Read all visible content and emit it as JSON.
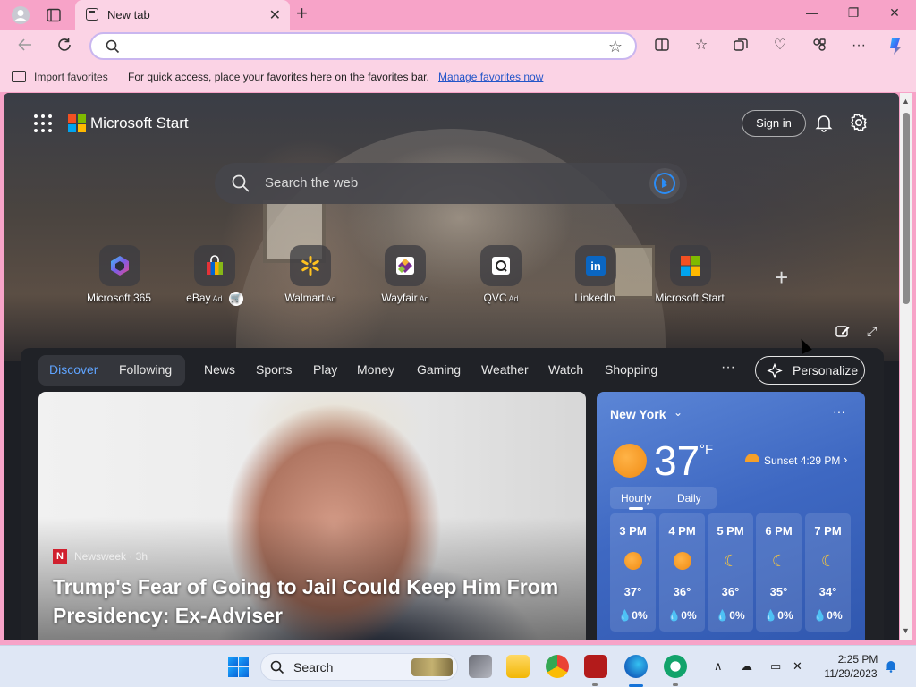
{
  "browser": {
    "tab_title": "New tab",
    "new_tab_glyph": "+",
    "address_value": "",
    "favorites_bar": {
      "import_label": "Import favorites",
      "message": "For quick access, place your favorites here on the favorites bar.",
      "link": "Manage favorites now"
    },
    "icons": [
      "profile-icon",
      "tab-actions-icon",
      "back-icon",
      "refresh-icon",
      "search-icon",
      "favorite-star-icon",
      "split-screen-icon",
      "favorites-icon",
      "collections-icon",
      "browser-essentials-icon",
      "extensions-icon",
      "more-icon",
      "copilot-icon"
    ]
  },
  "start": {
    "brand": "Microsoft Start",
    "sign_in": "Sign in",
    "search_placeholder": "Search the web",
    "tiles": [
      {
        "label": "Microsoft 365",
        "ad": ""
      },
      {
        "label": "eBay",
        "ad": "Ad"
      },
      {
        "label": "Walmart",
        "ad": "Ad"
      },
      {
        "label": "Wayfair",
        "ad": "Ad"
      },
      {
        "label": "QVC",
        "ad": "Ad"
      },
      {
        "label": "LinkedIn",
        "ad": ""
      },
      {
        "label": "Microsoft Start",
        "ad": ""
      }
    ]
  },
  "feed": {
    "nav": {
      "discover": "Discover",
      "following": "Following",
      "items": [
        "News",
        "Sports",
        "Play",
        "Money",
        "Gaming",
        "Weather",
        "Watch",
        "Shopping"
      ],
      "more": "···",
      "personalize": "Personalize"
    },
    "article": {
      "source_logo": "N",
      "source": "Newsweek · 3h",
      "headline": "Trump's Fear of Going to Jail Could Keep Him From Presidency: Ex-Adviser"
    }
  },
  "weather": {
    "city": "New York",
    "temp": "37",
    "unit": "°F",
    "sunset": "Sunset 4:29 PM",
    "tabs": [
      "Hourly",
      "Daily"
    ],
    "hourly": [
      {
        "time": "3 PM",
        "icon": "sun",
        "temp": "37°",
        "precip": "💧0%"
      },
      {
        "time": "4 PM",
        "icon": "sun",
        "temp": "36°",
        "precip": "💧0%"
      },
      {
        "time": "5 PM",
        "icon": "moon",
        "temp": "36°",
        "precip": "💧0%"
      },
      {
        "time": "6 PM",
        "icon": "moon",
        "temp": "35°",
        "precip": "💧0%"
      },
      {
        "time": "7 PM",
        "icon": "moon",
        "temp": "34°",
        "precip": "💧0%"
      }
    ]
  },
  "taskbar": {
    "search_label": "Search",
    "time": "2:25 PM",
    "date": "11/29/2023"
  },
  "colors": {
    "chrome": "#f7a3c8",
    "chrome_light": "#fbd3e5",
    "link": "#2456c9",
    "accent_blue": "#5fa4ff",
    "weather_card": "#3e68c2"
  }
}
